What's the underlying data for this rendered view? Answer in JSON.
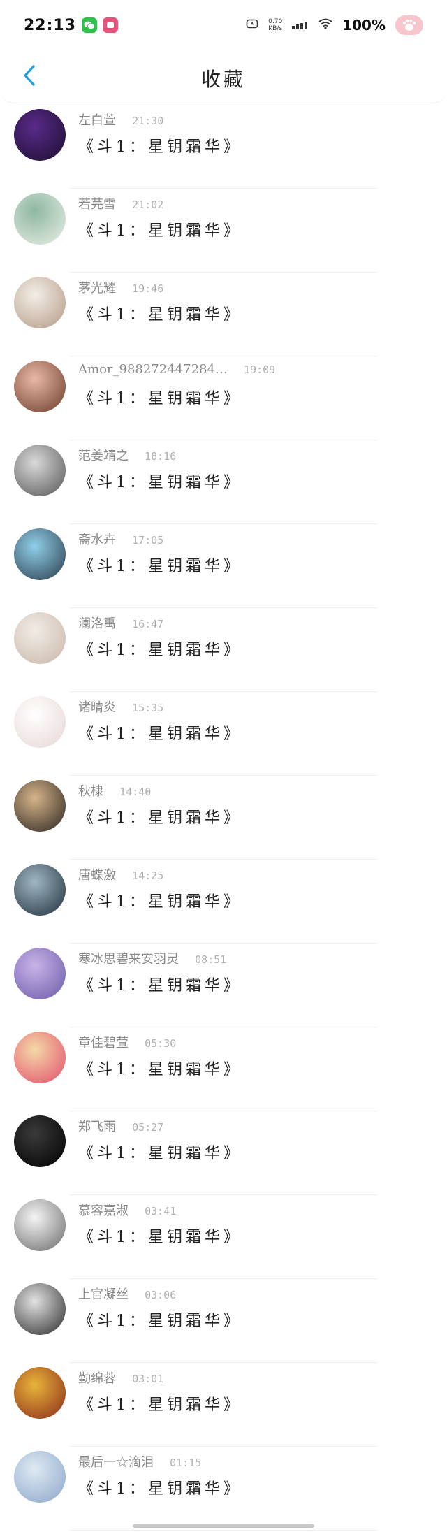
{
  "status_bar": {
    "time": "22:13",
    "net_speed_value": "0.70",
    "net_speed_unit": "KB/s",
    "battery": "100%"
  },
  "header": {
    "back_icon": "chevron-left-icon",
    "title": "收藏"
  },
  "items": [
    {
      "name": "左白萱",
      "time": "21:30",
      "message": "《斗1：星钥霜华》",
      "avatar_colors": [
        "#5a2a8a",
        "#1a0f2e"
      ]
    },
    {
      "name": "若芫雪",
      "time": "21:02",
      "message": "《斗1：星钥霜华》",
      "avatar_colors": [
        "#8fb7a2",
        "#e9efe6"
      ]
    },
    {
      "name": "茅光耀",
      "time": "19:46",
      "message": "《斗1：星钥霜华》",
      "avatar_colors": [
        "#f3eee8",
        "#b39a84"
      ]
    },
    {
      "name": "Amor_988272447284…",
      "time": "19:09",
      "message": "《斗1：星钥霜华》",
      "avatar_colors": [
        "#e9b9a6",
        "#6b3b2a"
      ]
    },
    {
      "name": "范姜靖之",
      "time": "18:16",
      "message": "《斗1：星钥霜华》",
      "avatar_colors": [
        "#d9d9d9",
        "#555555"
      ]
    },
    {
      "name": "斋水卉",
      "time": "17:05",
      "message": "《斗1：星钥霜华》",
      "avatar_colors": [
        "#8fcfe8",
        "#2b3a4a"
      ]
    },
    {
      "name": "澜洛禹",
      "time": "16:47",
      "message": "《斗1：星钥霜华》",
      "avatar_colors": [
        "#f1ece6",
        "#c9b6a8"
      ]
    },
    {
      "name": "诸晴炎",
      "time": "15:35",
      "message": "《斗1：星钥霜华》",
      "avatar_colors": [
        "#ffffff",
        "#e7d6d6"
      ]
    },
    {
      "name": "秋棣",
      "time": "14:40",
      "message": "《斗1：星钥霜华》",
      "avatar_colors": [
        "#d6b48a",
        "#2a2420"
      ]
    },
    {
      "name": "唐蝶激",
      "time": "14:25",
      "message": "《斗1：星钥霜华》",
      "avatar_colors": [
        "#9fb7c2",
        "#1f2f3c"
      ]
    },
    {
      "name": "寒冰思碧来安羽灵",
      "time": "08:51",
      "message": "《斗1：星钥霜华》",
      "avatar_colors": [
        "#c9b3e8",
        "#6a5aa8"
      ]
    },
    {
      "name": "章佳碧萱",
      "time": "05:30",
      "message": "《斗1：星钥霜华》",
      "avatar_colors": [
        "#f4d9a8",
        "#e24c6b"
      ]
    },
    {
      "name": "郑飞雨",
      "time": "05:27",
      "message": "《斗1：星钥霜华》",
      "avatar_colors": [
        "#3a3a3a",
        "#000000"
      ]
    },
    {
      "name": "慕容嘉淑",
      "time": "03:41",
      "message": "《斗1：星钥霜华》",
      "avatar_colors": [
        "#f5f5f5",
        "#6a6a6a"
      ]
    },
    {
      "name": "上官凝丝",
      "time": "03:06",
      "message": "《斗1：星钥霜华》",
      "avatar_colors": [
        "#e2e2e2",
        "#2a2a2a"
      ]
    },
    {
      "name": "勤绵蓉",
      "time": "03:01",
      "message": "《斗1：星钥霜华》",
      "avatar_colors": [
        "#e8b43a",
        "#8a2a1a"
      ]
    },
    {
      "name": "最后一☆滴泪",
      "time": "01:15",
      "message": "《斗1：星钥霜华》",
      "avatar_colors": [
        "#dfe9f3",
        "#8aa6c8"
      ]
    }
  ]
}
